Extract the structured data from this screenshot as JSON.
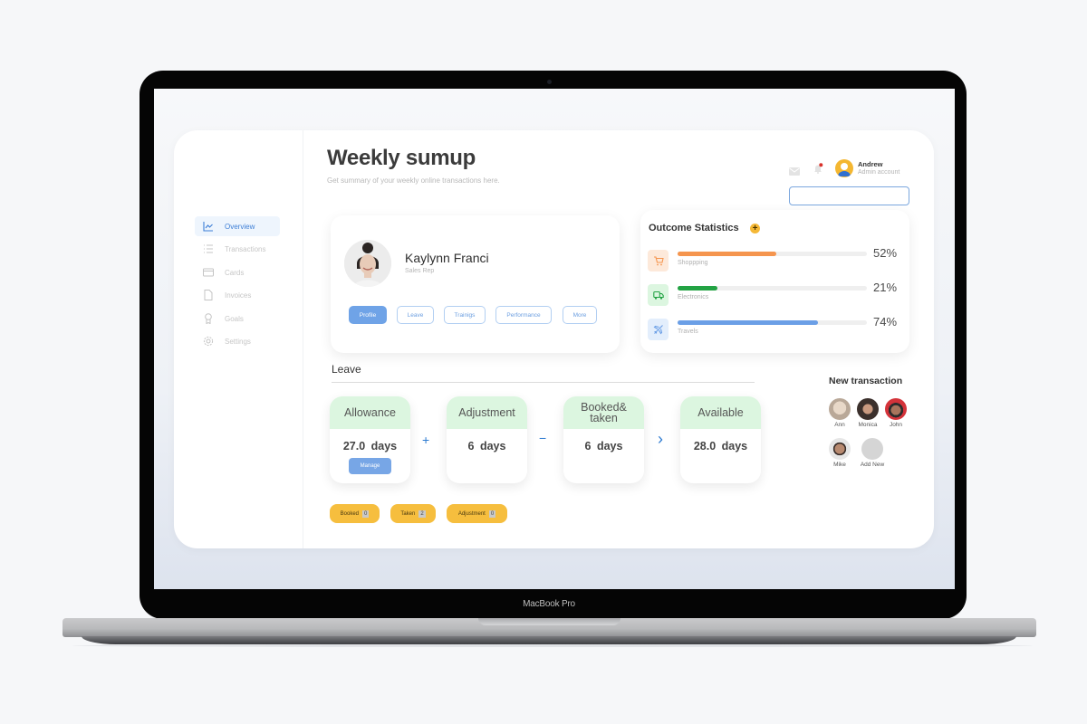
{
  "device": {
    "label": "MacBook Pro"
  },
  "sidebar": {
    "items": [
      {
        "label": "Overview",
        "icon": "chart-line-icon",
        "active": true
      },
      {
        "label": "Transactions",
        "icon": "list-icon",
        "active": false
      },
      {
        "label": "Cards",
        "icon": "credit-card-icon",
        "active": false
      },
      {
        "label": "Invoices",
        "icon": "document-icon",
        "active": false
      },
      {
        "label": "Goals",
        "icon": "award-icon",
        "active": false
      },
      {
        "label": "Settings",
        "icon": "gear-icon",
        "active": false
      }
    ]
  },
  "header": {
    "title": "Weekly sumup",
    "subtitle": "Get summary of your weekly online transactions here.",
    "user": {
      "name": "Andrew",
      "role": "Admin account"
    },
    "search": {
      "value": "",
      "placeholder": ""
    },
    "notification_dot_color": "#d9322b"
  },
  "profile": {
    "name": "Kaylynn Franci",
    "role": "Sales Rep",
    "tabs": [
      {
        "label": "Profile",
        "active": true
      },
      {
        "label": "Leave",
        "active": false
      },
      {
        "label": "Trainigs",
        "active": false
      },
      {
        "label": "Performance",
        "active": false
      },
      {
        "label": "More",
        "active": false
      }
    ]
  },
  "outcome_statistics": {
    "title": "Outcome Statistics",
    "add_label": "+",
    "items": [
      {
        "label": "Shoppping",
        "percent": 52,
        "percent_label": "52%",
        "icon": "shopping-cart-icon",
        "color": "#f5954e",
        "bg": "#fde9da"
      },
      {
        "label": "Electronics",
        "percent": 21,
        "percent_label": "21%",
        "icon": "truck-icon",
        "color": "#23a344",
        "bg": "#dcf6e0"
      },
      {
        "label": "Travels",
        "percent": 74,
        "percent_label": "74%",
        "icon": "airplane-icon",
        "color": "#6b9fe6",
        "bg": "#e3eefc"
      }
    ]
  },
  "leave": {
    "title": "Leave",
    "cards": [
      {
        "label": "Allowance",
        "value": "27.0  days",
        "action": "Manage"
      },
      {
        "label": "Adjustment",
        "value": "6  days"
      },
      {
        "label": "Booked& taken",
        "value": "6  days"
      },
      {
        "label": "Available",
        "value": "28.0  days"
      }
    ],
    "operators": [
      "+",
      "−",
      "›"
    ],
    "tags": [
      {
        "label": "Booked",
        "count": "0"
      },
      {
        "label": "Taken",
        "count": "2"
      },
      {
        "label": "Adjustment",
        "count": "0"
      }
    ]
  },
  "new_transaction": {
    "title": "New transaction",
    "people": [
      {
        "name": "Ann"
      },
      {
        "name": "Monica"
      },
      {
        "name": "John"
      },
      {
        "name": "Mike"
      },
      {
        "name": "Add New"
      }
    ]
  }
}
